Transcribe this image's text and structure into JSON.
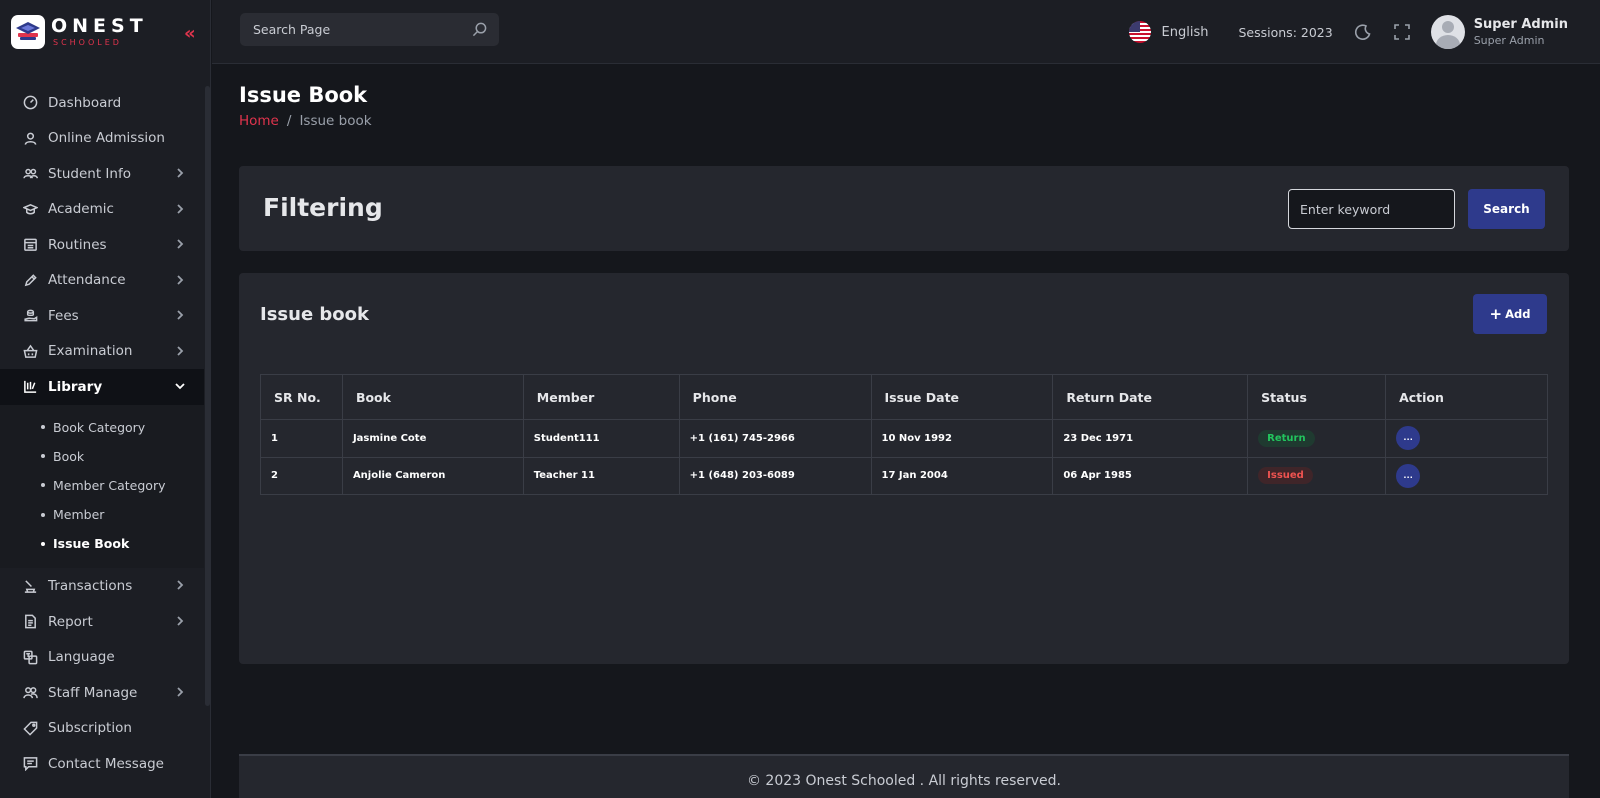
{
  "brand": {
    "name": "ONEST",
    "sub": "SCHOOLED"
  },
  "sidebar": {
    "items": [
      {
        "label": "Dashboard",
        "icon": "dashboard-icon",
        "chevron": false
      },
      {
        "label": "Online Admission",
        "icon": "user-icon",
        "chevron": false
      },
      {
        "label": "Student Info",
        "icon": "users-icon",
        "chevron": true
      },
      {
        "label": "Academic",
        "icon": "graduation-cap-icon",
        "chevron": true
      },
      {
        "label": "Routines",
        "icon": "calendar-icon",
        "chevron": true
      },
      {
        "label": "Attendance",
        "icon": "pen-icon",
        "chevron": true
      },
      {
        "label": "Fees",
        "icon": "coins-icon",
        "chevron": true
      },
      {
        "label": "Examination",
        "icon": "basket-icon",
        "chevron": true
      },
      {
        "label": "Library",
        "icon": "library-icon",
        "chevron": true,
        "active": true
      }
    ],
    "library_sub": [
      {
        "label": "Book Category"
      },
      {
        "label": "Book"
      },
      {
        "label": "Member Category"
      },
      {
        "label": "Member"
      },
      {
        "label": "Issue Book",
        "active": true
      }
    ],
    "items_after": [
      {
        "label": "Transactions",
        "icon": "transactions-icon",
        "chevron": true
      },
      {
        "label": "Report",
        "icon": "report-icon",
        "chevron": true
      },
      {
        "label": "Language",
        "icon": "language-icon",
        "chevron": false
      },
      {
        "label": "Staff Manage",
        "icon": "staff-icon",
        "chevron": true
      },
      {
        "label": "Subscription",
        "icon": "tag-icon",
        "chevron": false
      },
      {
        "label": "Contact Message",
        "icon": "message-icon",
        "chevron": false
      }
    ]
  },
  "header": {
    "search_placeholder": "Search Page",
    "language": "English",
    "sessions": "Sessions: 2023",
    "user_name": "Super Admin",
    "user_role": "Super Admin"
  },
  "page": {
    "title": "Issue Book",
    "breadcrumb_home": "Home",
    "breadcrumb_sep": "/",
    "breadcrumb_current": "Issue book"
  },
  "filter": {
    "title": "Filtering",
    "keyword_placeholder": "Enter keyword",
    "search_label": "Search"
  },
  "issue_list": {
    "title": "Issue book",
    "add_label": "Add",
    "add_plus": "+",
    "columns": [
      "SR No.",
      "Book",
      "Member",
      "Phone",
      "Issue Date",
      "Return Date",
      "Status",
      "Action"
    ],
    "rows": [
      {
        "sr": "1",
        "book": "Jasmine Cote",
        "member": "Student111",
        "phone": "+1 (161) 745-2966",
        "issue_date": "10 Nov 1992",
        "return_date": "23 Dec 1971",
        "status": "Return",
        "action": "…"
      },
      {
        "sr": "2",
        "book": "Anjolie Cameron",
        "member": "Teacher 11",
        "phone": "+1 (648) 203-6089",
        "issue_date": "17 Jan 2004",
        "return_date": "06 Apr 1985",
        "status": "Issued",
        "action": "…"
      }
    ]
  },
  "footer": {
    "text": "© 2023 Onest Schooled . All rights reserved."
  },
  "colors": {
    "accent": "#e0344d",
    "primary": "#2e3a8c",
    "success": "#22c55e",
    "danger": "#ef5350"
  }
}
